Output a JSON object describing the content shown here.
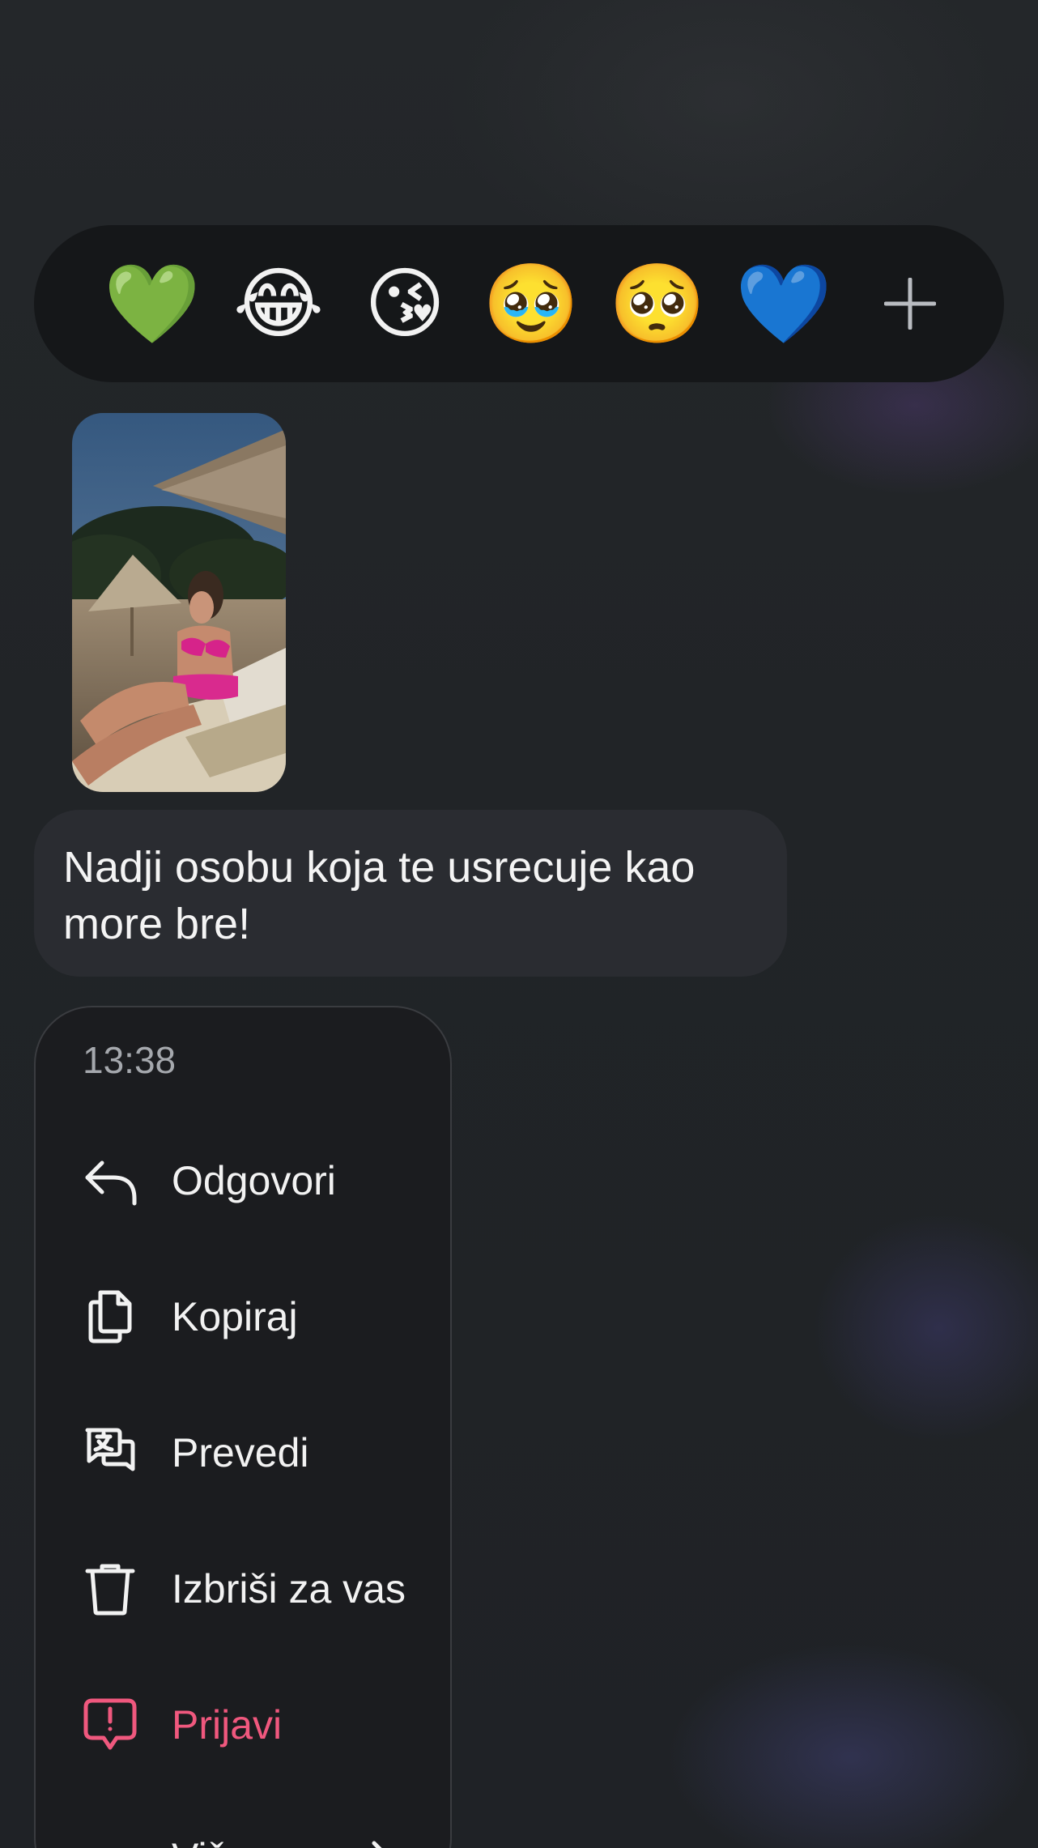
{
  "reactions": {
    "items": [
      {
        "emoji": "💚",
        "name": "green-heart"
      },
      {
        "emoji": "😂",
        "name": "tears-of-joy"
      },
      {
        "emoji": "😘",
        "name": "blowing-kiss"
      },
      {
        "emoji": "🥹",
        "name": "holding-back-tears"
      },
      {
        "emoji": "🥺",
        "name": "pleading-face"
      },
      {
        "emoji": "💙",
        "name": "blue-heart"
      }
    ],
    "more_icon": "plus-icon"
  },
  "message": {
    "text": "Nadji osobu koja te usrecuje kao more bre!"
  },
  "menu": {
    "time": "13:38",
    "items": [
      {
        "label": "Odgovori",
        "icon": "reply-icon"
      },
      {
        "label": "Kopiraj",
        "icon": "copy-icon"
      },
      {
        "label": "Prevedi",
        "icon": "translate-icon"
      },
      {
        "label": "Izbriši za vas",
        "icon": "trash-icon"
      },
      {
        "label": "Prijavi",
        "icon": "report-icon"
      },
      {
        "label": "Više",
        "icon": "chevron-right-icon"
      }
    ]
  },
  "colors": {
    "background": "#1f2124",
    "reaction_bar": "#151719",
    "bubble": "#2a2c31",
    "menu": "#1b1c1f",
    "danger": "#f0587e",
    "muted_text": "#a5a8ad"
  }
}
